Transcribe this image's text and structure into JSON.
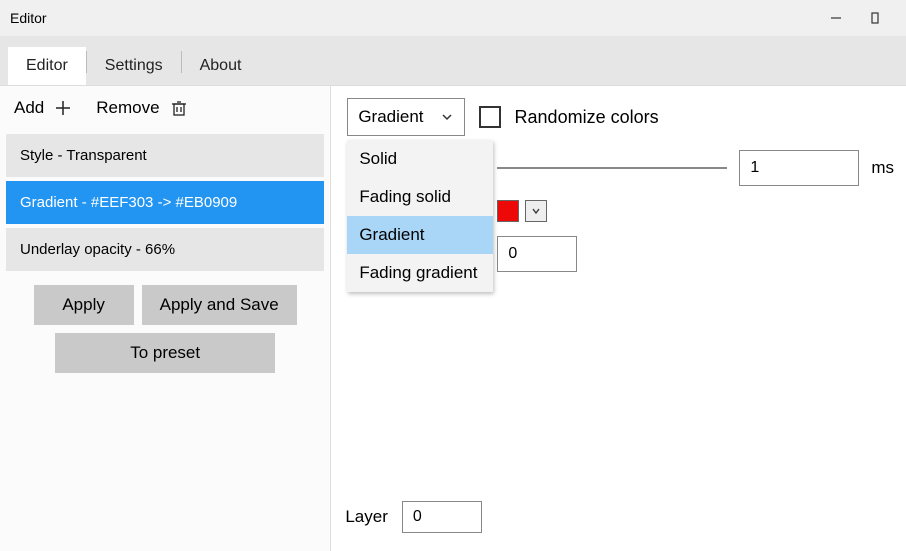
{
  "window": {
    "title": "Editor"
  },
  "tabs": {
    "items": [
      {
        "label": "Editor"
      },
      {
        "label": "Settings"
      },
      {
        "label": "About"
      }
    ]
  },
  "leftToolbar": {
    "add_label": "Add",
    "remove_label": "Remove"
  },
  "leftList": {
    "items": [
      {
        "label": "Style - Transparent"
      },
      {
        "label": "Gradient - #EEF303 -> #EB0909"
      },
      {
        "label": "Underlay opacity - 66%"
      }
    ]
  },
  "leftButtons": {
    "apply": "Apply",
    "apply_save": "Apply and Save",
    "to_preset": "To preset"
  },
  "right": {
    "combo_value": "Gradient",
    "randomize_label": "Randomize colors",
    "duration_value": "1",
    "duration_unit": "ms",
    "numeric_value": "0",
    "layer_label": "Layer",
    "layer_value": "0",
    "color_hex": "#ee0909",
    "dropdown_options": [
      {
        "label": "Solid"
      },
      {
        "label": "Fading solid"
      },
      {
        "label": "Gradient"
      },
      {
        "label": "Fading gradient"
      }
    ]
  }
}
